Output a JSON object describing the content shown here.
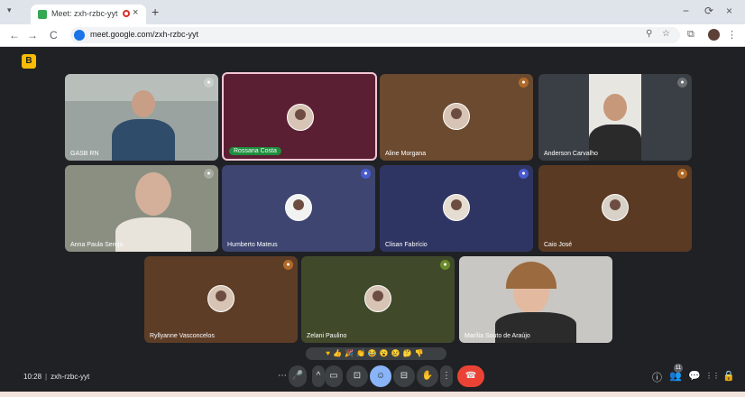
{
  "browser": {
    "tab_title": "Meet: zxh-rzbc-yyt",
    "url": "meet.google.com/zxh-rzbc-yyt",
    "tab_menu_icon": "▾",
    "tab_close": "×",
    "new_tab": "+",
    "minimize": "−",
    "restore": "⟳",
    "close": "×",
    "back": "←",
    "forward": "→",
    "reload": "C",
    "zoom_icon": "⚲",
    "star_icon": "☆",
    "extensions_icon": "⧉",
    "menu_icon": "⋮"
  },
  "meeting": {
    "time": "10:28",
    "code": "zxh-rzbc-yyt",
    "badge_icon": "B",
    "reactions": "♥👍🎉👏😂😮😢🤔👎"
  },
  "participants": [
    {
      "name": "GASB RN",
      "kind": "video"
    },
    {
      "name": "Rossana Costa",
      "kind": "avatar",
      "speaking": true
    },
    {
      "name": "Aline Morgana",
      "kind": "avatar"
    },
    {
      "name": "Anderson Carvalho",
      "kind": "video"
    },
    {
      "name": "Anna Paula Serejo",
      "kind": "video"
    },
    {
      "name": "Humberto Mateus",
      "kind": "avatar"
    },
    {
      "name": "Clisan Fabrício",
      "kind": "avatar"
    },
    {
      "name": "Caio José",
      "kind": "avatar"
    },
    {
      "name": "Ryllyanne Vasconcelos",
      "kind": "avatar"
    },
    {
      "name": "Zelani Paulino",
      "kind": "avatar"
    },
    {
      "name": "Marília Souto de Araújo",
      "kind": "video"
    }
  ],
  "colors": {
    "tile_gasb": "#9aa3a0",
    "tile_rossana": "#5b1f33",
    "tile_aline": "#6b4a2f",
    "tile_anderson": "#3a3f45",
    "tile_anna": "#8a8f82",
    "tile_humberto": "#3d4570",
    "tile_clisan": "#2f3562",
    "tile_caio": "#5a3a22",
    "tile_ryllyanne": "#5e3d27",
    "tile_zelani": "#404a2a",
    "tile_marilia": "#c9c7c3",
    "end_call": "#ea4335",
    "active_control": "#8ab4f8"
  },
  "controls": {
    "more_left": "⋯",
    "mic": "🎤",
    "caret": "^",
    "camera": "▭",
    "present": "⊡",
    "emoji": "☺",
    "captions": "⊟",
    "raise_hand": "✋",
    "more": "⋮",
    "end_call": "☎",
    "info": "ⓘ",
    "people": "👥",
    "people_count": "11",
    "chat": "💬",
    "activities": "⋮⋮",
    "host": "🔒"
  }
}
